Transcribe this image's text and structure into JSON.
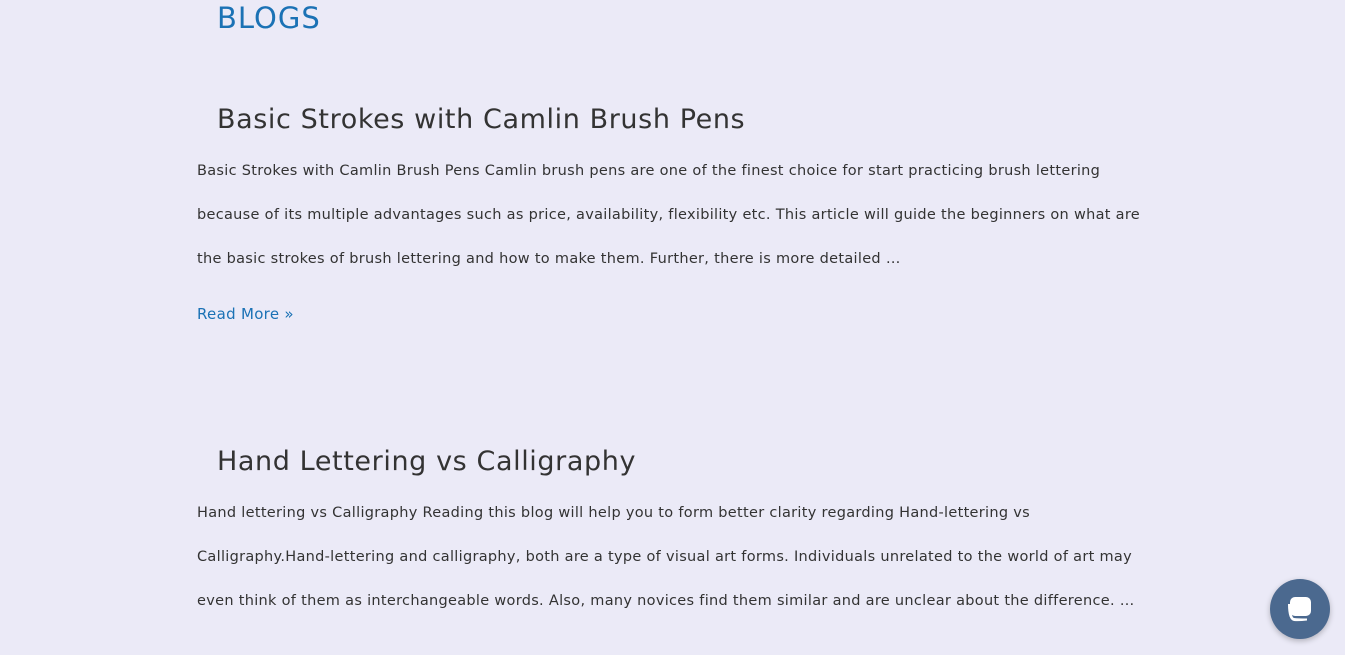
{
  "page": {
    "heading": "BLOGS"
  },
  "posts": [
    {
      "title": "Basic Strokes with Camlin Brush Pens",
      "excerpt": "Basic Strokes with Camlin Brush Pens Camlin brush pens are one of the finest choice for start practicing brush lettering because of its multiple advantages such as price, availability, flexibility etc. This article will guide the beginners on what are the basic strokes of brush lettering and how to make them. Further, there is more detailed …",
      "read_more": "Read More »"
    },
    {
      "title": "Hand Lettering vs Calligraphy",
      "excerpt": "Hand lettering vs Calligraphy Reading this blog will help you to form better clarity regarding Hand-lettering vs Calligraphy.Hand-lettering and calligraphy, both are a type of visual art forms. Individuals unrelated to the world of art may even think of them as interchangeable words. Also, many novices find them similar and are unclear about the difference. …"
    }
  ],
  "chat_widget": {
    "icon": "chat-bubble-icon"
  },
  "colors": {
    "background": "#ebeaf7",
    "accent": "#1b72b5",
    "text": "#333333",
    "chat_button": "#4b698f"
  }
}
